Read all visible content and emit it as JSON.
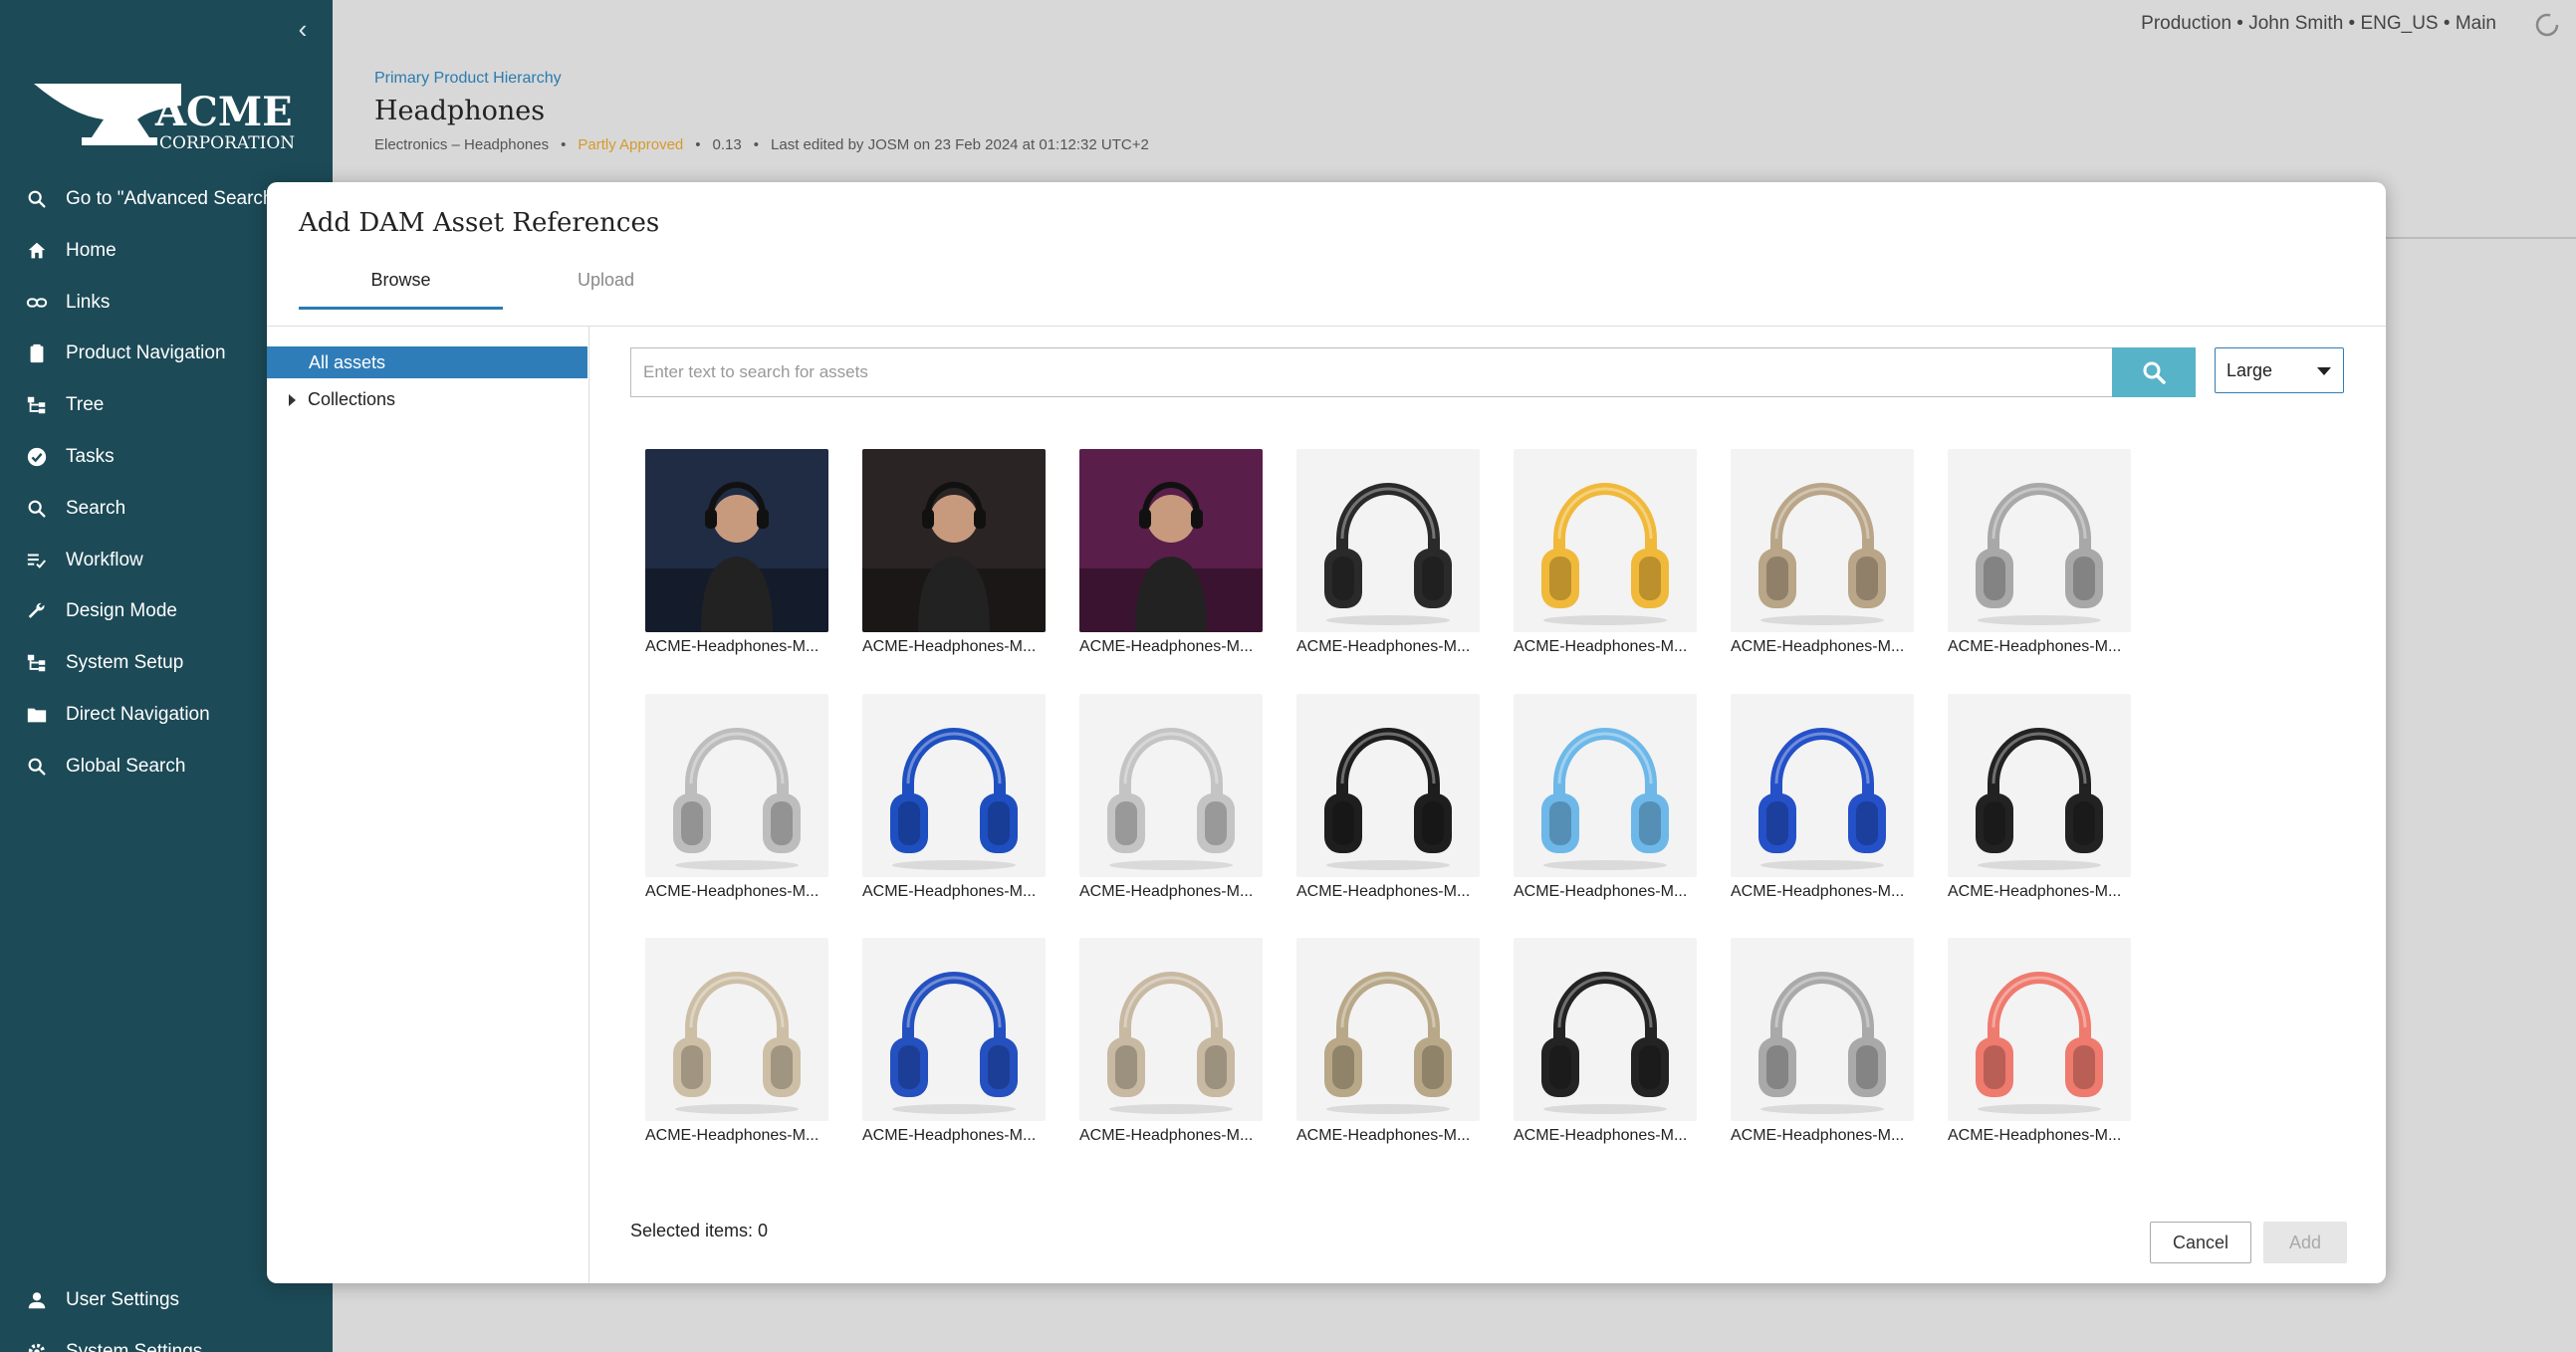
{
  "topbar": {
    "context": "Production • John Smith • ENG_US • Main"
  },
  "sidebar": {
    "logo_text": "ACME",
    "logo_sub": "CORPORATION",
    "items": [
      {
        "label": "Go to \"Advanced Search",
        "icon": "search-icon"
      },
      {
        "label": "Home",
        "icon": "home-icon"
      },
      {
        "label": "Links",
        "icon": "link-icon"
      },
      {
        "label": "Product Navigation",
        "icon": "clipboard-icon"
      },
      {
        "label": "Tree",
        "icon": "tree-icon"
      },
      {
        "label": "Tasks",
        "icon": "check-circle-icon"
      },
      {
        "label": "Search",
        "icon": "search-icon"
      },
      {
        "label": "Workflow",
        "icon": "workflow-icon"
      },
      {
        "label": "Design Mode",
        "icon": "wrench-icon"
      },
      {
        "label": "System Setup",
        "icon": "tree-icon"
      },
      {
        "label": "Direct Navigation",
        "icon": "folder-icon"
      },
      {
        "label": "Global Search",
        "icon": "search-icon"
      }
    ],
    "bottom_items": [
      {
        "label": "User Settings",
        "icon": "user-icon"
      },
      {
        "label": "System Settings",
        "icon": "gear-icon"
      }
    ]
  },
  "page": {
    "breadcrumb": "Primary Product Hierarchy",
    "title": "Headphones",
    "path": "Electronics – Headphones",
    "status": "Partly Approved",
    "version": "0.13",
    "edited": "Last edited by JOSM on 23 Feb 2024 at 01:12:32 UTC+2"
  },
  "modal": {
    "title": "Add DAM Asset References",
    "tabs": [
      "Browse",
      "Upload"
    ],
    "tree": {
      "all_assets": "All assets",
      "collections": "Collections"
    },
    "search_placeholder": "Enter text to search for assets",
    "size_value": "Large",
    "selected_label": "Selected items: 0",
    "cancel_label": "Cancel",
    "add_label": "Add",
    "assets": [
      {
        "caption": "ACME-Headphones-M...",
        "kind": "photo",
        "color": "#1f2c44"
      },
      {
        "caption": "ACME-Headphones-M...",
        "kind": "photo",
        "color": "#2b2424"
      },
      {
        "caption": "ACME-Headphones-M...",
        "kind": "photo",
        "color": "#5a1e4a"
      },
      {
        "caption": "ACME-Headphones-M...",
        "kind": "product",
        "color": "#2a2a2a"
      },
      {
        "caption": "ACME-Headphones-M...",
        "kind": "product",
        "color": "#f0b93a"
      },
      {
        "caption": "ACME-Headphones-M...",
        "kind": "product",
        "color": "#b9a587"
      },
      {
        "caption": "ACME-Headphones-M...",
        "kind": "product",
        "color": "#a8a8a8"
      },
      {
        "caption": "ACME-Headphones-M...",
        "kind": "product",
        "color": "#bdbdbd"
      },
      {
        "caption": "ACME-Headphones-M...",
        "kind": "product",
        "color": "#1e4fc0"
      },
      {
        "caption": "ACME-Headphones-M...",
        "kind": "product",
        "color": "#c4c4c4"
      },
      {
        "caption": "ACME-Headphones-M...",
        "kind": "product",
        "color": "#1e1e1e"
      },
      {
        "caption": "ACME-Headphones-M...",
        "kind": "product",
        "color": "#6db8e8"
      },
      {
        "caption": "ACME-Headphones-M...",
        "kind": "product",
        "color": "#2450c8"
      },
      {
        "caption": "ACME-Headphones-M...",
        "kind": "product",
        "color": "#222222"
      },
      {
        "caption": "ACME-Headphones-M...",
        "kind": "product",
        "color": "#cdbfa6"
      },
      {
        "caption": "ACME-Headphones-M...",
        "kind": "product",
        "color": "#2450c0"
      },
      {
        "caption": "ACME-Headphones-M...",
        "kind": "product",
        "color": "#c8b9a2"
      },
      {
        "caption": "ACME-Headphones-M...",
        "kind": "product",
        "color": "#b8a888"
      },
      {
        "caption": "ACME-Headphones-M...",
        "kind": "product",
        "color": "#232323"
      },
      {
        "caption": "ACME-Headphones-M...",
        "kind": "product",
        "color": "#a9a9a9"
      },
      {
        "caption": "ACME-Headphones-M...",
        "kind": "product",
        "color": "#ef7a6e"
      }
    ]
  },
  "colors": {
    "sidebar": "#1c4a57",
    "accent": "#2f7db8",
    "search_button": "#57b3c8",
    "status": "#d59a2a"
  }
}
